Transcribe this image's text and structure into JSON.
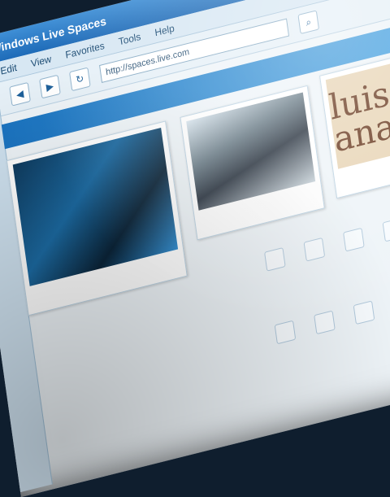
{
  "window": {
    "title": "Windows Live Spaces"
  },
  "menu": {
    "items": [
      "Edit",
      "View",
      "Favorites",
      "Tools",
      "Help"
    ]
  },
  "toolbar": {
    "address": "http://spaces.live.com"
  },
  "content": {
    "heading": "",
    "cards": [
      {
        "caption": ""
      },
      {
        "caption": ""
      },
      {
        "logo": "luis ana",
        "caption": ""
      }
    ],
    "section_title": ""
  }
}
